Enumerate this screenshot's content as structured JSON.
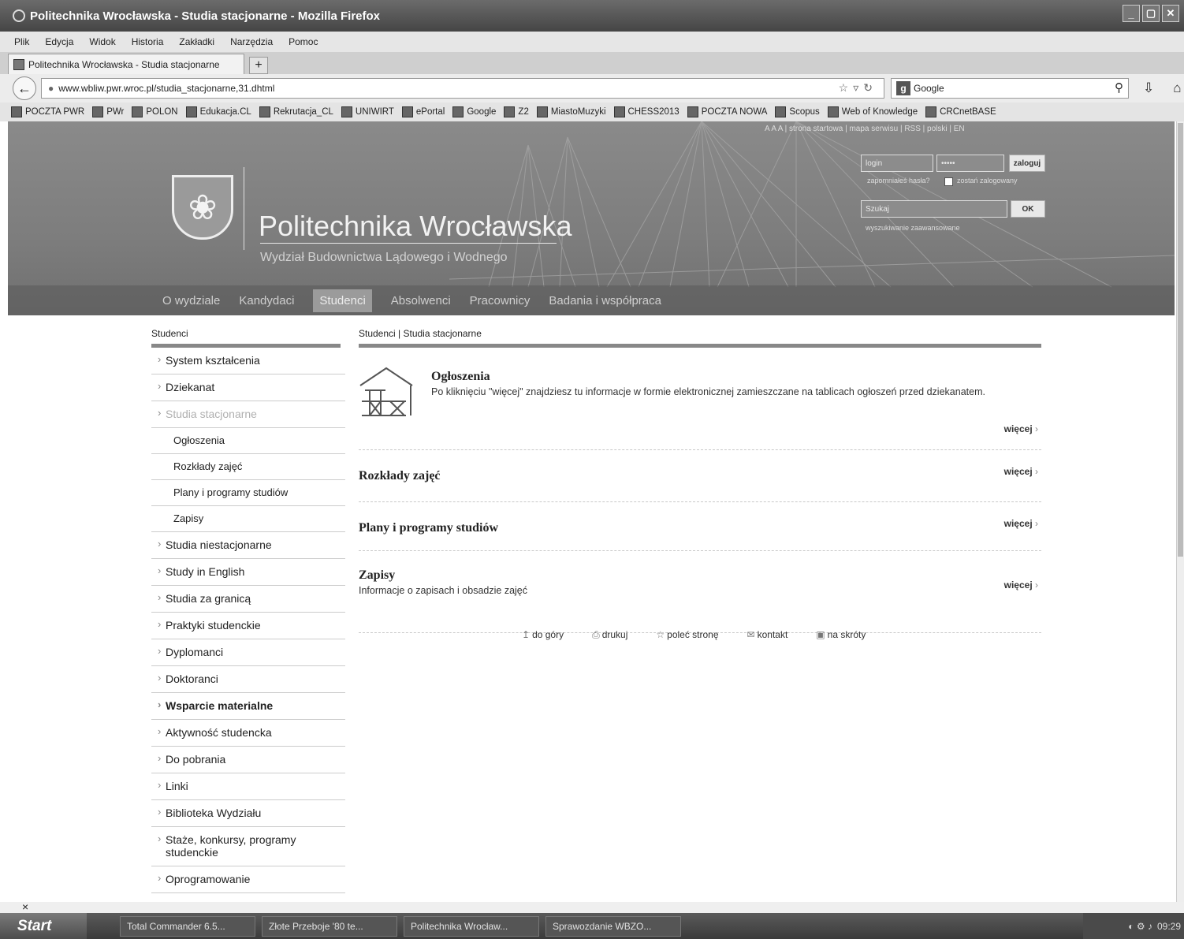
{
  "window": {
    "title": "Politechnika Wrocławska - Studia stacjonarne - Mozilla Firefox"
  },
  "menu": [
    "Plik",
    "Edycja",
    "Widok",
    "Historia",
    "Zakładki",
    "Narzędzia",
    "Pomoc"
  ],
  "tab": {
    "label": "Politechnika Wrocławska - Studia stacjonarne",
    "new_tab": "+"
  },
  "navbar": {
    "url": "www.wbliw.pwr.wroc.pl/studia_stacjonarne,31.dhtml",
    "search_engine": "Google",
    "search_placeholder": "Google"
  },
  "bookmarks": [
    "POCZTA PWR",
    "PWr",
    "POLON",
    "Edukacja.CL",
    "Rekrutacja_CL",
    "UNIWIRT",
    "ePortal",
    "Google",
    "Z2",
    "MiastoMuzyki",
    "CHESS2013",
    "POCZTA NOWA",
    "Scopus",
    "Web of Knowledge",
    "CRCnetBASE"
  ],
  "site": {
    "top_links": "A A A  |  strona startowa  |  mapa serwisu  |  RSS  |  polski  |  EN",
    "university": "Politechnika Wrocławska",
    "department": "Wydział Budownictwa Lądowego i Wodnego",
    "login": {
      "login_placeholder": "login",
      "password_value": "•••••",
      "submit": "zaloguj",
      "forgot": "zapomniałeś hasła?",
      "remember": "zostań zalogowany",
      "search_placeholder": "Szukaj",
      "search_button": "OK",
      "advanced": "wyszukiwanie zaawansowane"
    },
    "nav": [
      "O wydziale",
      "Kandydaci",
      "Studenci",
      "Absolwenci",
      "Pracownicy",
      "Badania i współpraca"
    ]
  },
  "sidebar": {
    "title": "Studenci",
    "items": [
      "System kształcenia",
      "Dziekanat",
      "Studia stacjonarne",
      "Ogłoszenia",
      "Rozkłady zajęć",
      "Plany i programy studiów",
      "Zapisy",
      "Studia niestacjonarne",
      "Study in English",
      "Studia za granicą",
      "Praktyki studenckie",
      "Dyplomanci",
      "Doktoranci",
      "Wsparcie materialne",
      "Aktywność studencka",
      "Do pobrania",
      "Linki",
      "Biblioteka Wydziału",
      "Staże, konkursy, programy studenckie",
      "Oprogramowanie"
    ]
  },
  "content": {
    "breadcrumb": "Studenci | Studia stacjonarne",
    "sections": [
      {
        "title": "Ogłoszenia",
        "desc": "Po kliknięciu \"więcej\" znajdziesz tu informacje w formie elektronicznej zamieszczane na tablicach ogłoszeń przed dziekanatem.",
        "more": "więcej"
      },
      {
        "title": "Rozkłady zajęć",
        "desc": "",
        "more": "więcej"
      },
      {
        "title": "Plany i programy studiów",
        "desc": "",
        "more": "więcej"
      },
      {
        "title": "Zapisy",
        "desc": "Informacje o zapisach i obsadzie zajęć",
        "more": "więcej"
      }
    ],
    "util": [
      "do góry",
      "drukuj",
      "poleć stronę",
      "kontakt",
      "na skróty"
    ]
  },
  "findbar": {
    "close": "×"
  },
  "taskbar": {
    "start": "Start",
    "tasks": [
      "Total Commander 6.5...",
      "Złote Przeboje '80 te...",
      "Politechnika Wrocław...",
      "Sprawozdanie WBZO..."
    ],
    "clock": "09:29"
  },
  "icons": {
    "back": "back-arrow-icon",
    "star": "bookmark-star-icon",
    "reload": "reload-icon",
    "search": "magnifier-icon",
    "download": "download-icon",
    "home": "home-icon"
  }
}
